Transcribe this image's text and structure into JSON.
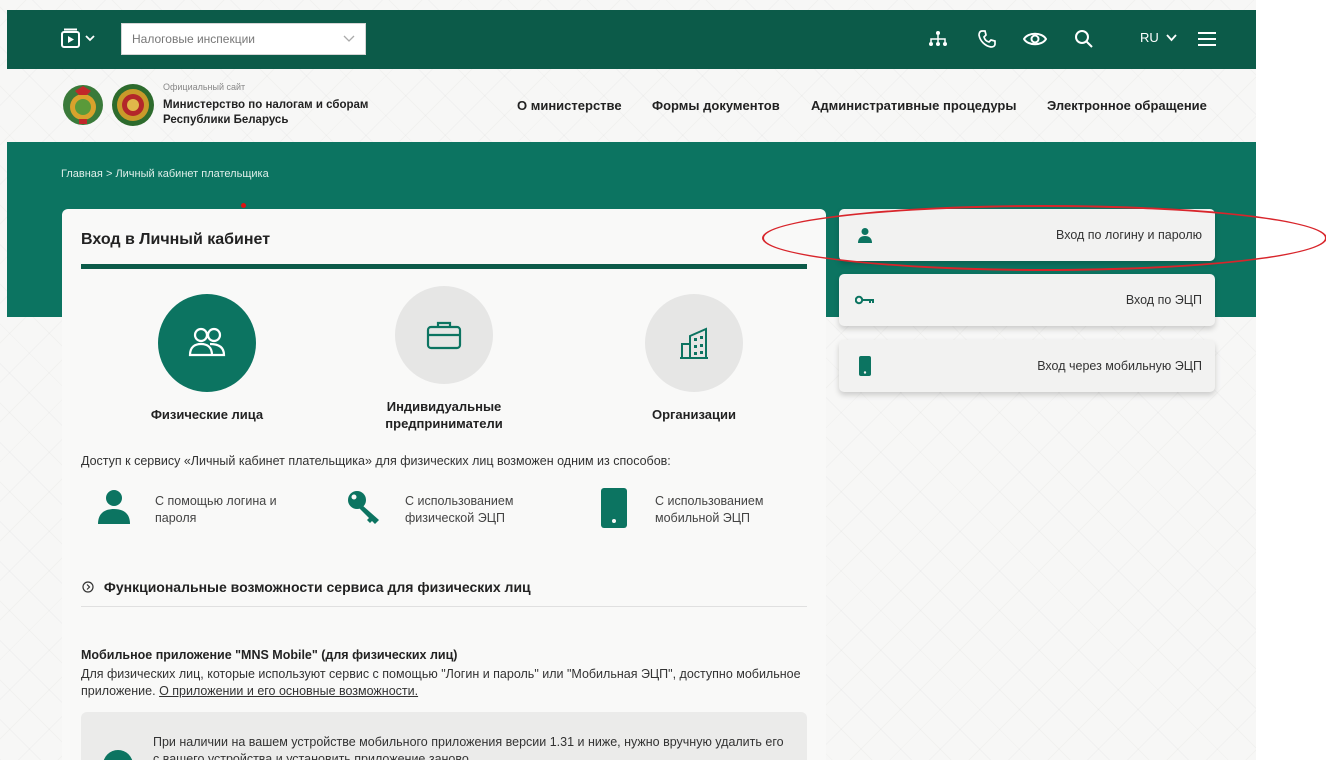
{
  "topbar": {
    "select_value": "Налоговые инспекции",
    "language": "RU",
    "icons": [
      "video-icon",
      "sitemap-icon",
      "phone-icon",
      "eye-icon",
      "search-icon",
      "menu-icon"
    ]
  },
  "header": {
    "site_small": "Официальный сайт",
    "site_name_line1": "Министерство по налогам и сборам",
    "site_name_line2": "Республики Беларусь",
    "nav": [
      "О министерстве",
      "Формы документов",
      "Административные процедуры",
      "Электронное обращение"
    ]
  },
  "breadcrumb": {
    "home": "Главная",
    "separator": ">",
    "current": "Личный кабинет плательщика"
  },
  "card": {
    "title": "Вход в Личный кабинет",
    "categories": [
      {
        "label": "Физические лица",
        "icon": "users-icon"
      },
      {
        "label_line1": "Индивидуальные",
        "label_line2": "предприниматели",
        "icon": "briefcase-icon"
      },
      {
        "label": "Организации",
        "icon": "building-icon"
      }
    ],
    "access_text": "Доступ к сервису «Личный кабинет плательщика» для физических лиц возможен одним из способов:",
    "methods": [
      {
        "line1": "С помощью логина и",
        "line2": "пароля",
        "icon": "person-icon"
      },
      {
        "line1": "С использованием",
        "line2": "физической ЭЦП",
        "icon": "key-icon"
      },
      {
        "line1": "С использованием",
        "line2": "мобильной ЭЦП",
        "icon": "phone-device-icon"
      }
    ],
    "functions_title": "Функциональные возможности сервиса для физических лиц",
    "mobile_title": "Мобильное приложение \"MNS Mobile\" (для физических лиц)",
    "mobile_text": "Для физических лиц, которые используют сервис с помощью \"Логин и пароль\" или \"Мобильная ЭЦП\", доступно мобильное приложение.",
    "mobile_link": "О приложении и его основные возможности.",
    "notice_text": "При наличии на вашем устройстве мобильного приложения версии 1.31 и ниже, нужно вручную удалить его с вашего устройства и установить приложение заново."
  },
  "login_options": [
    {
      "label": "Вход по логину и паролю",
      "icon": "person-icon"
    },
    {
      "label": "Вход по ЭЦП",
      "icon": "key-icon"
    },
    {
      "label": "Вход через мобильную ЭЦП",
      "icon": "phone-device-icon"
    }
  ],
  "colors": {
    "topbar": "#0c5b49",
    "band": "#0c7461",
    "accent": "#0c7461",
    "highlight": "#d8252b"
  }
}
